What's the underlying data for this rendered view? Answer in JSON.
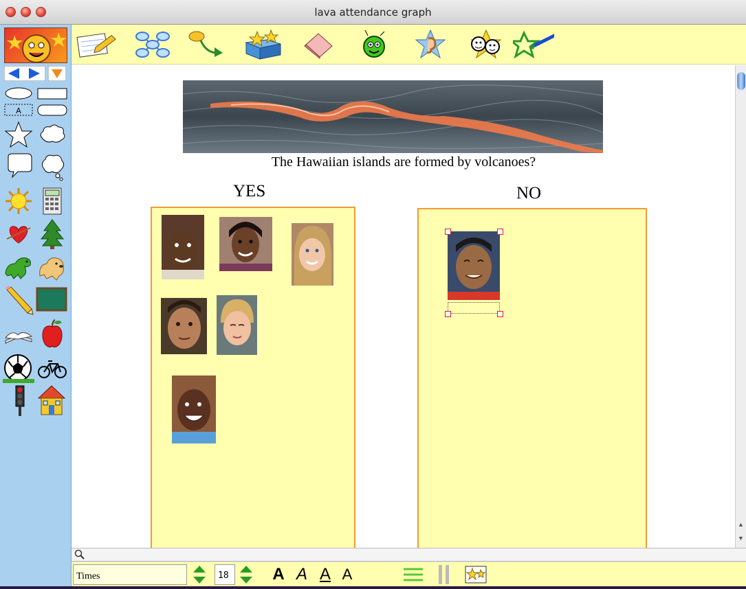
{
  "window": {
    "title": "lava attendance graph"
  },
  "toolbar": {
    "tools": [
      {
        "name": "draw-tool-icon"
      },
      {
        "name": "web-diagram-icon"
      },
      {
        "name": "link-arrow-icon"
      },
      {
        "name": "stamp-box-icon"
      },
      {
        "name": "eraser-icon"
      },
      {
        "name": "cursor-face-icon"
      },
      {
        "name": "sound-ear-icon"
      },
      {
        "name": "faces-icon"
      },
      {
        "name": "paint-brush-icon"
      }
    ]
  },
  "palette": {
    "items": [
      "ellipse-shape-icon",
      "rectangle-shape-icon",
      "text-box-shape-icon",
      "rounded-rect-shape-icon",
      "star-shape-icon",
      "cloud-shape-icon",
      "speech-bubble-icon",
      "thought-bubble-icon",
      "sun-icon",
      "calculator-icon",
      "heart-icon",
      "tree-icon",
      "dinosaur-icon",
      "dog-icon",
      "pencil-icon",
      "chalkboard-icon",
      "book-icon",
      "apple-icon",
      "soccer-ball-icon",
      "bicycle-icon",
      "traffic-light-icon",
      "house-icon"
    ]
  },
  "canvas": {
    "question": "The Hawaiian islands are formed by volcanoes?",
    "yes_label": "YES",
    "no_label": "NO"
  },
  "format": {
    "font": "Times",
    "size": "18",
    "bold_glyph": "A",
    "italic_glyph": "A",
    "underline_glyph": "A",
    "color_glyph": "A"
  },
  "colors": {
    "toolbar_bg": "#ffffaf",
    "palette_bg": "#aad0f0",
    "box_border": "#f29a35",
    "selection_handle": "#e0202a"
  }
}
